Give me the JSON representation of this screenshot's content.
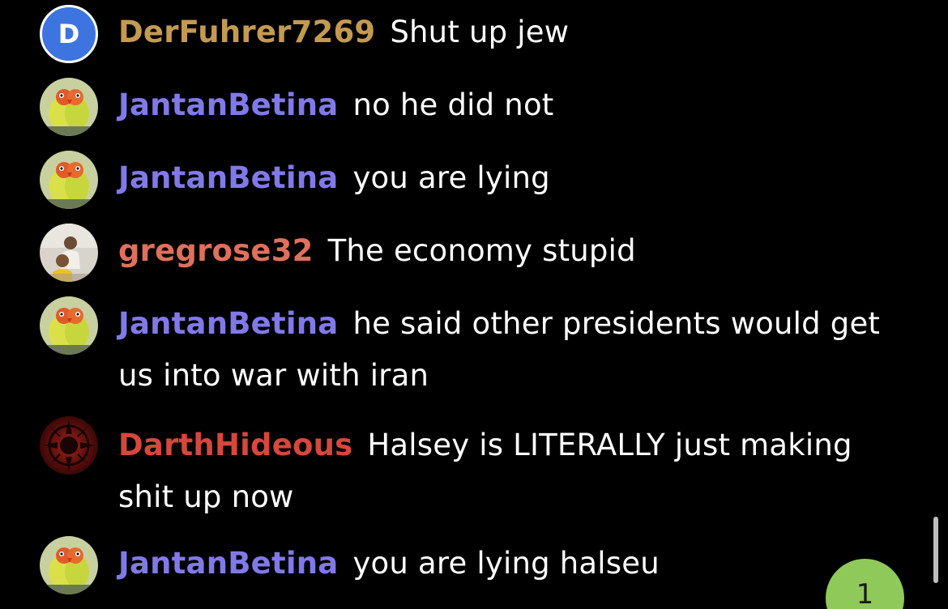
{
  "colors": {
    "derfuhrer": "#c49a52",
    "jantan": "#8179e8",
    "gregrose": "#e0705b",
    "darth": "#d6473c",
    "badge": "#8fc95a"
  },
  "messages": [
    {
      "username": "DerFuhrer7269",
      "text": "Shut up jew",
      "avatar": "letter",
      "avatar_letter": "D"
    },
    {
      "username": "JantanBetina",
      "text": "no he did not",
      "avatar": "lovebirds-icon"
    },
    {
      "username": "JantanBetina",
      "text": "you are lying",
      "avatar": "lovebirds-icon"
    },
    {
      "username": "gregrose32",
      "text": "The economy stupid",
      "avatar": "photo-icon"
    },
    {
      "username": "JantanBetina",
      "text": "he said other presidents would get us into war with iran",
      "avatar": "lovebirds-icon"
    },
    {
      "username": "DarthHideous",
      "text": "Halsey is LITERALLY just making shit up now",
      "avatar": "sith-emblem-icon"
    },
    {
      "username": "JantanBetina",
      "text": "you are lying halseu",
      "avatar": "lovebirds-icon"
    }
  ],
  "unread_badge": "1"
}
